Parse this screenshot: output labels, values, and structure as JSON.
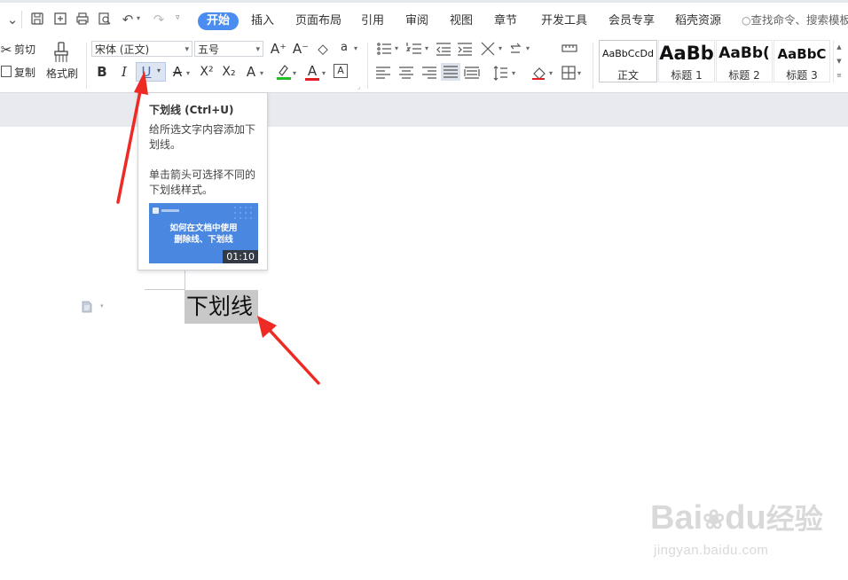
{
  "menu": {
    "tabs": [
      "开始",
      "插入",
      "页面布局",
      "引用",
      "审阅",
      "视图",
      "章节",
      "开发工具",
      "会员专享",
      "稻壳资源"
    ],
    "active_tab": "开始",
    "search_text": "查找命令、搜索模板"
  },
  "ribbon": {
    "cut_label": "剪切",
    "copy_label": "复制",
    "format_painter_label": "格式刷",
    "font_name": "宋体 (正文)",
    "font_size": "五号",
    "bold": "B",
    "italic": "I",
    "underline": "U",
    "strike": "A",
    "superscript": "X²",
    "subscript": "X₂",
    "text_effect": "A",
    "font_color": "A",
    "char_border": "A",
    "grow_font": "A⁺",
    "shrink_font": "A⁻",
    "phonetic": "a",
    "styles": [
      {
        "sample": "AaBbCcDd",
        "name": "正文"
      },
      {
        "sample": "AaBb",
        "name": "标题 1"
      },
      {
        "sample": "AaBb(",
        "name": "标题 2"
      },
      {
        "sample": "AaBbC",
        "name": "标题 3"
      }
    ]
  },
  "tooltip": {
    "title": "下划线 (Ctrl+U)",
    "line1": "给所选文字内容添加下划线。",
    "line2": "单击箭头可选择不同的下划线样式。",
    "thumb_title": "如何在文档中使用",
    "thumb_subtitle": "删除线、下划线",
    "duration": "01:10"
  },
  "document": {
    "selected_text": "下划线"
  },
  "watermark": {
    "brand": "Bai",
    "brand2": "du",
    "brand3": "经验",
    "url": "jingyan.baidu.com"
  },
  "colors": {
    "accent": "#4a8cf0",
    "highlight_bar": "#22c022",
    "font_color_bar": "#e02020",
    "arrow": "#ee2a24",
    "selection": "#c8c8c8"
  }
}
